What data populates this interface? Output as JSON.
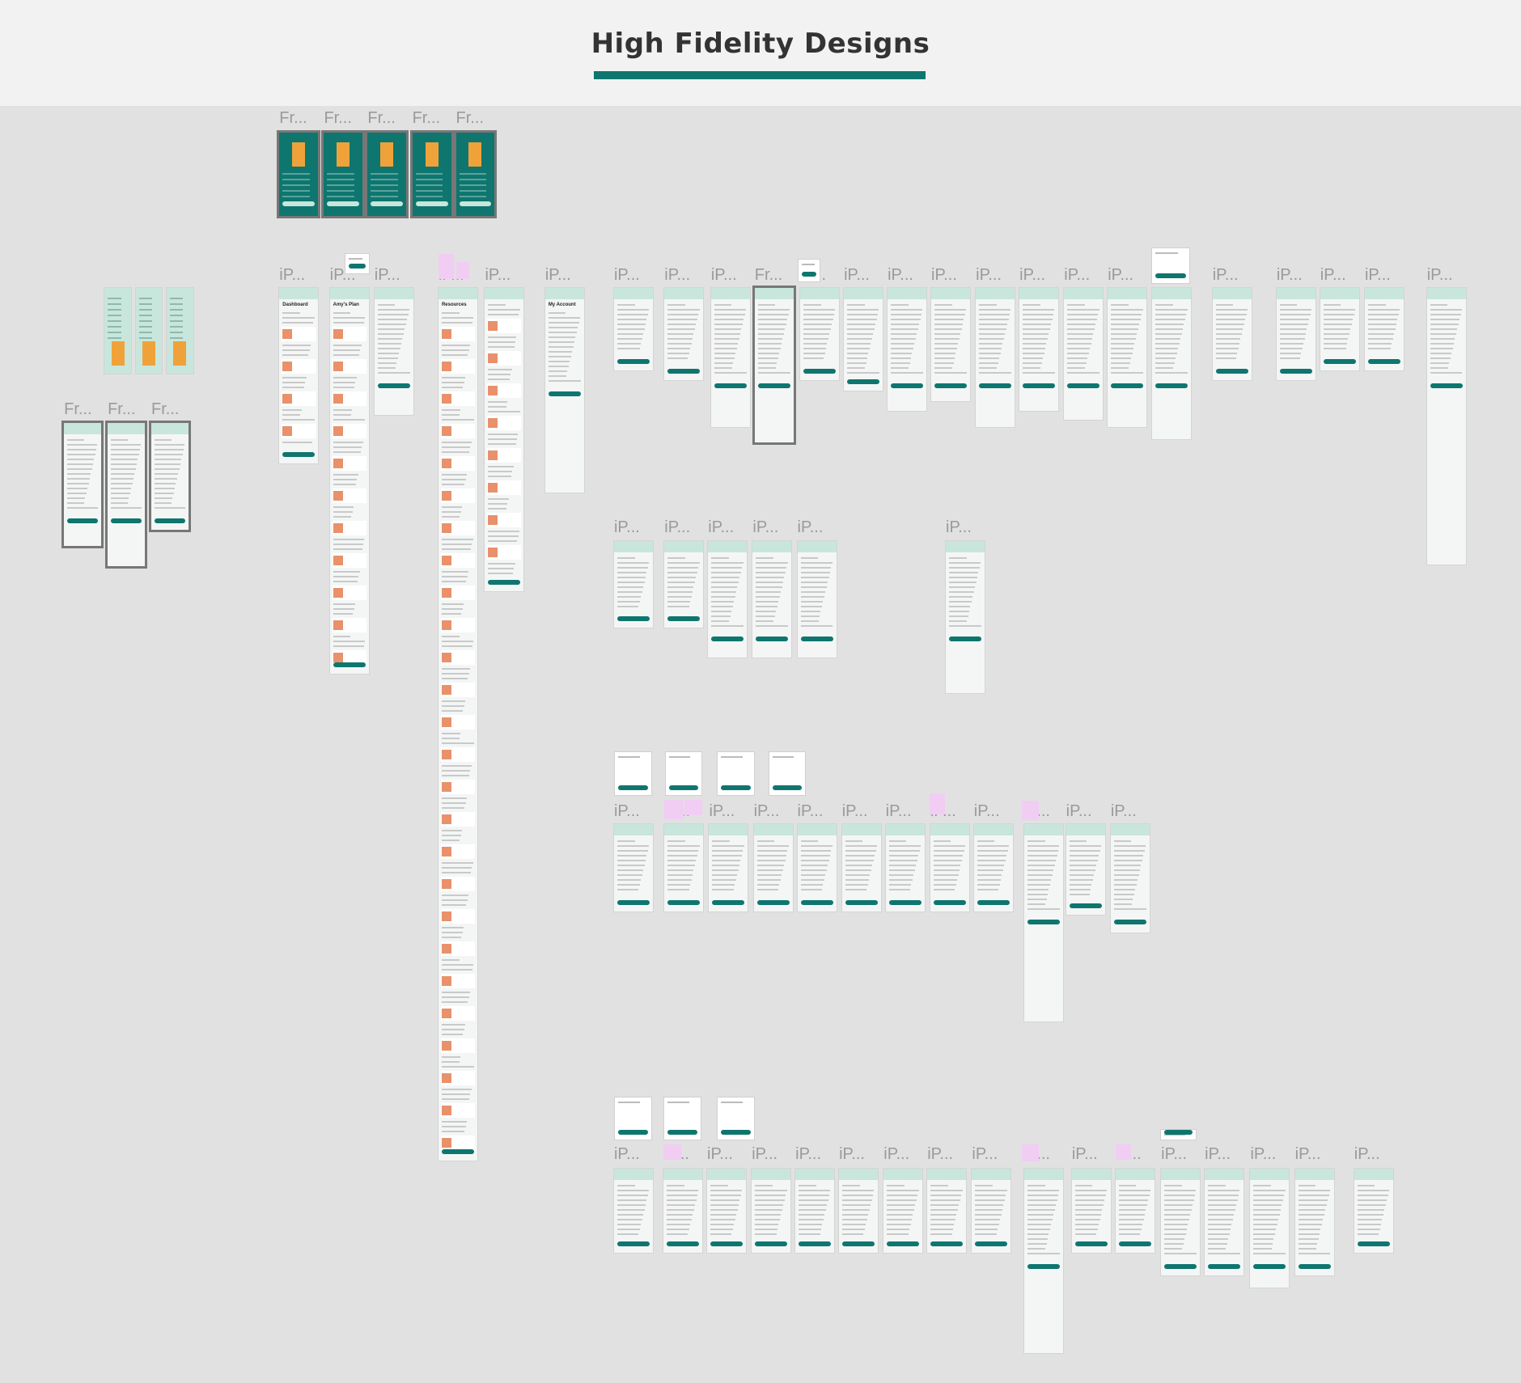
{
  "page": {
    "title": "High Fidelity Designs"
  },
  "colors": {
    "accent": "#0e766f",
    "mint": "#c8e6dc",
    "canvas": "#e1e1e1",
    "header_bg": "#f2f2f2",
    "sticky": "#f1cdf3"
  },
  "frame_labels": {
    "frame": "Fr...",
    "iphone": "iP..."
  },
  "screen_titles": {
    "dashboard": "Dashboard",
    "plan": "Amy's Plan",
    "resources": "Resources",
    "account": "My Account"
  }
}
